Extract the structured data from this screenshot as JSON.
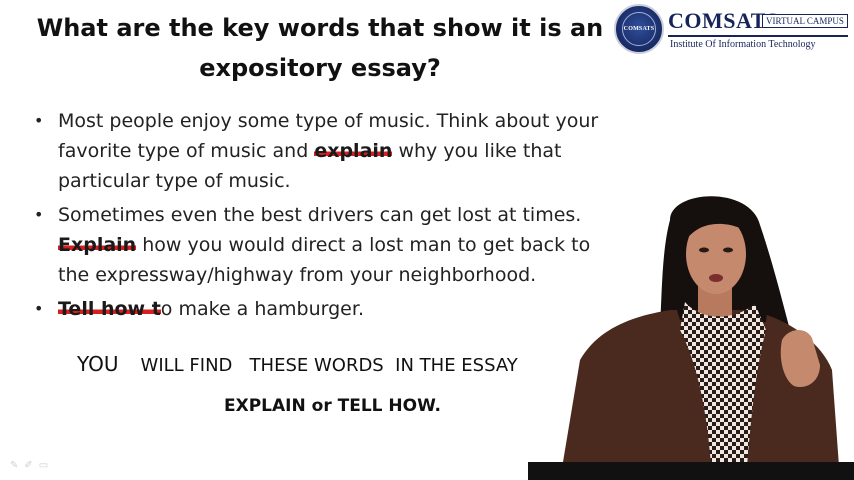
{
  "slide": {
    "title": "What are the key words that show it is an expository essay?",
    "bullets": [
      {
        "before": "Most people enjoy some type of music. Think about your favorite type of music and ",
        "keyword": "explain",
        "after": " why you like that particular type of music."
      },
      {
        "before": "Sometimes even the best drivers can get lost at times. ",
        "keyword": "Explain",
        "after": " how you would direct a lost man to get back to the expressway/highway from your neighborhood."
      },
      {
        "before": "",
        "keyword": "Tell how t",
        "after": "o make a hamburger."
      }
    ],
    "find_line": {
      "you": "YOU",
      "rest": "WILL FIND   THESE WORDS  IN THE ESSAY"
    },
    "emphasis": "EXPLAIN or TELL HOW."
  },
  "logo": {
    "seal_text": "COMSATS",
    "name": "COMSATS",
    "badge": "VIRTUAL CAMPUS",
    "subtitle": "Institute Of Information Technology"
  },
  "colors": {
    "highlight": "#d81f1f",
    "brand": "#16245a"
  },
  "icons": [
    "pen-icon",
    "eraser-icon",
    "slides-icon"
  ]
}
